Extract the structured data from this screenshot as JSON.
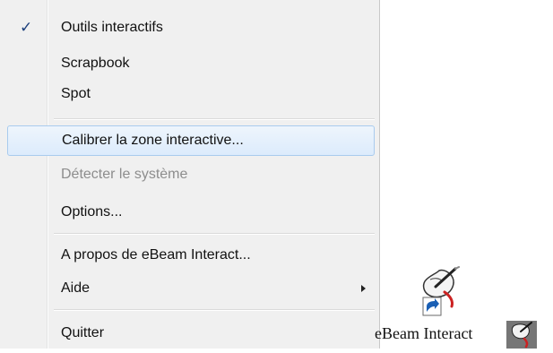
{
  "menu": {
    "items": [
      {
        "label": "Outils interactifs",
        "checked": true,
        "disabled": false
      },
      {
        "label": "Scrapbook",
        "checked": false,
        "disabled": false
      },
      {
        "label": "Spot",
        "checked": false,
        "disabled": false
      },
      {
        "label": "Calibrer la zone interactive...",
        "checked": false,
        "disabled": false,
        "highlighted": true
      },
      {
        "label": "Détecter le système",
        "checked": false,
        "disabled": true
      },
      {
        "label": "Options...",
        "checked": false,
        "disabled": false
      },
      {
        "label": "A propos de eBeam Interact...",
        "checked": false,
        "disabled": false
      },
      {
        "label": "Aide",
        "checked": false,
        "disabled": false,
        "submenu": true
      },
      {
        "label": "Quitter",
        "checked": false,
        "disabled": false
      }
    ],
    "check_glyph": "✓",
    "submenu_icon": "chevron-right-icon"
  },
  "desktop": {
    "shortcut_label": "eBeam Interact",
    "shortcut_icon": "ebeam-interact-shortcut-icon",
    "tray_icon": "ebeam-tray-icon"
  },
  "colors": {
    "menu_background": "#f0f0f0",
    "highlight_border": "#a9cbee",
    "highlight_fill": "#dcebfc",
    "disabled_text": "#8d8d8d",
    "check": "#1c3f7c"
  }
}
